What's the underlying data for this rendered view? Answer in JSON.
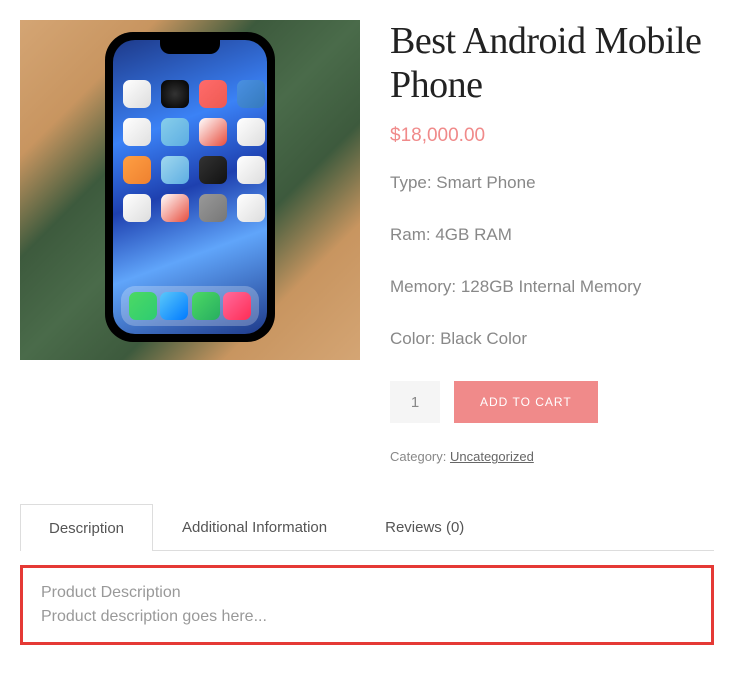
{
  "product": {
    "title": "Best Android Mo­bile Phone",
    "price": "$18,000.00",
    "specs": {
      "type": "Type: Smart Phone",
      "ram": "Ram: 4GB RAM",
      "memory": "Memory: 128GB Internal Memory",
      "color": "Color: Black Color"
    },
    "qty": "1",
    "add_to_cart_label": "ADD TO CART",
    "category_label": "Category: ",
    "category_value": "Uncategorized"
  },
  "tabs": {
    "description": "Description",
    "additional_info": "Additional Information",
    "reviews": "Reviews (0)"
  },
  "description_panel": {
    "heading": "Product Description",
    "body": "Product description goes here..."
  }
}
